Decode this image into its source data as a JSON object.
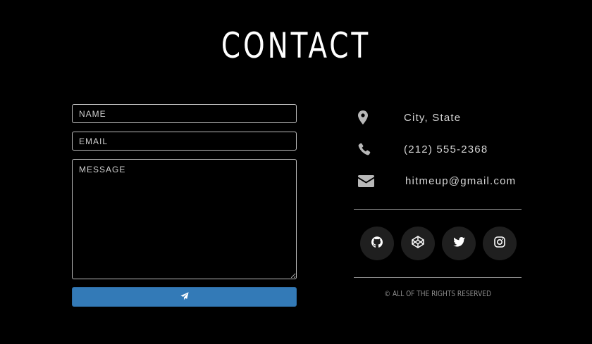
{
  "page": {
    "title": "CONTACT"
  },
  "form": {
    "name_placeholder": "NAME",
    "email_placeholder": "EMAIL",
    "message_placeholder": "MESSAGE",
    "name_value": "",
    "email_value": "",
    "message_value": "",
    "submit_icon": "paper-plane-icon",
    "submit_color": "#337ab7"
  },
  "contact_info": {
    "location": {
      "icon": "map-marker-icon",
      "text": "City, State"
    },
    "phone": {
      "icon": "phone-icon",
      "text": "(212) 555-2368"
    },
    "email": {
      "icon": "envelope-icon",
      "text": "hitmeup@gmail.com"
    }
  },
  "social": [
    {
      "icon": "github-icon"
    },
    {
      "icon": "codepen-icon"
    },
    {
      "icon": "twitter-icon"
    },
    {
      "icon": "instagram-icon"
    }
  ],
  "footer": {
    "copyright": "© ALL OF THE RIGHTS RESERVED"
  },
  "colors": {
    "background": "#000000",
    "text": "#ffffff",
    "muted": "#8c8c8c",
    "social_bg": "#1f1f1f"
  }
}
